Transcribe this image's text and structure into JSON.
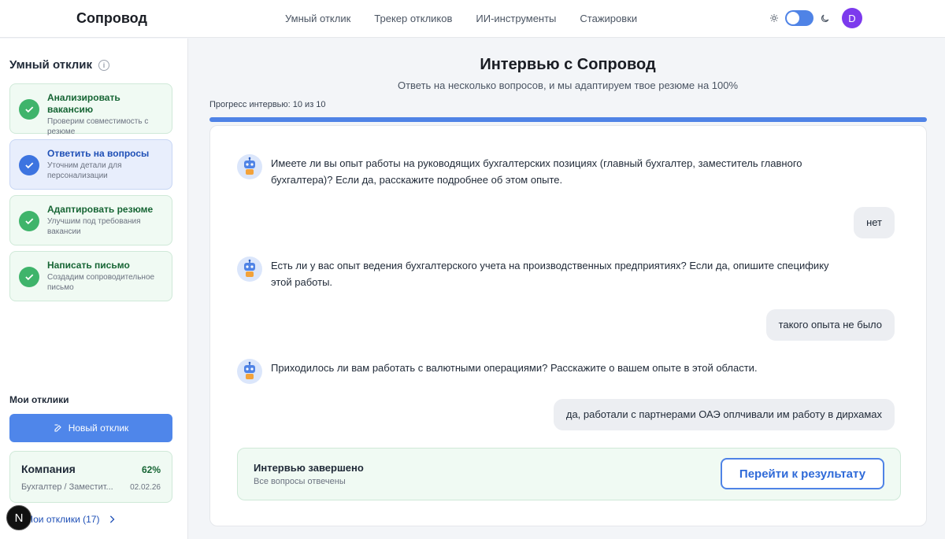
{
  "header": {
    "logo": "Сопровод",
    "nav": [
      "Умный отклик",
      "Трекер откликов",
      "ИИ-инструменты",
      "Стажировки"
    ],
    "avatar_letter": "D"
  },
  "sidebar": {
    "title": "Умный отклик",
    "steps": [
      {
        "title": "Анализировать вакансию",
        "subtitle": "Проверим совместимость с резюме",
        "status": "done"
      },
      {
        "title": "Ответить на вопросы",
        "subtitle": "Уточним детали для персонализации",
        "status": "active"
      },
      {
        "title": "Адаптировать резюме",
        "subtitle": "Улучшим под требования вакансии",
        "status": "done"
      },
      {
        "title": "Написать письмо",
        "subtitle": "Создадим сопроводительное письмо",
        "status": "done"
      }
    ],
    "my_responses_label": "Мои отклики",
    "new_response_button": "Новый отклик",
    "card": {
      "company": "Компания",
      "percent": "62%",
      "role": "Бухгалтер / Заместит...",
      "date": "02.02.26"
    },
    "all_responses_link": "Мои отклики (17)",
    "badge_letter": "N"
  },
  "main": {
    "title": "Интервью с Сопровод",
    "subtitle": "Ответь на несколько вопросов, и мы адаптируем твое резюме на 100%",
    "progress_label": "Прогресс интервью: 10 из 10",
    "progress_fraction": 1.0,
    "messages": [
      {
        "role": "bot",
        "text": "Имеете ли вы опыт работы на руководящих бухгалтерских позициях (главный бухгалтер, заместитель главного бухгалтера)? Если да, расскажите подробнее об этом опыте."
      },
      {
        "role": "user",
        "text": "нет"
      },
      {
        "role": "bot",
        "text": "Есть ли у вас опыт ведения бухгалтерского учета на производственных предприятиях? Если да, опишите специфику этой работы."
      },
      {
        "role": "user",
        "text": "такого опыта не было"
      },
      {
        "role": "bot",
        "text": "Приходилось ли вам работать с валютными операциями? Расскажите о вашем опыте в этой области."
      },
      {
        "role": "user",
        "text": "да, работали с партнерами ОАЭ оплчивали им работу в дирхамах"
      }
    ],
    "completion": {
      "title": "Интервью завершено",
      "subtitle": "Все вопросы отвечены",
      "button": "Перейти к результату"
    }
  },
  "colors": {
    "accent": "#4f83e6",
    "success": "#3fb46b",
    "avatar": "#7c3aed"
  }
}
